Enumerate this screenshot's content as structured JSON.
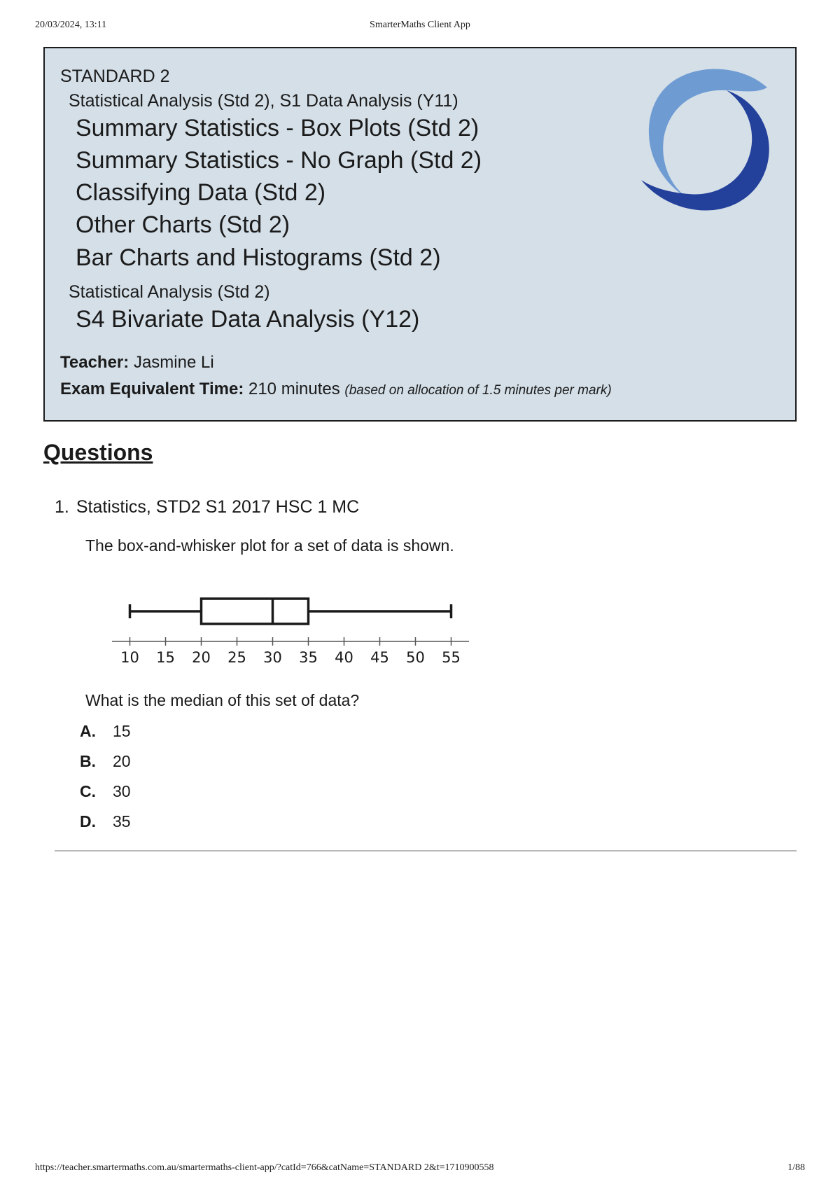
{
  "print_header": {
    "datetime": "20/03/2024, 13:11",
    "title": "SmarterMaths Client App"
  },
  "banner": {
    "course": "STANDARD 2",
    "categories": [
      "Statistical Analysis (Std 2), S1 Data Analysis (Y11)",
      "Statistical Analysis (Std 2)"
    ],
    "topics": [
      "Summary Statistics - Box Plots (Std 2)",
      "Summary Statistics - No Graph (Std 2)",
      "Classifying Data (Std 2)",
      "Other Charts (Std 2)",
      "Bar Charts and Histograms (Std 2)",
      "S4 Bivariate Data Analysis (Y12)"
    ],
    "teacher_label": "Teacher:",
    "teacher_name": "Jasmine Li",
    "exam_time_label": "Exam Equivalent Time:",
    "exam_time_value": "210 minutes",
    "exam_time_note": "(based on allocation of 1.5 minutes per mark)",
    "logo_colors": {
      "light": "#6f9bd3",
      "dark": "#23409a"
    }
  },
  "questions_heading": "Questions",
  "question": {
    "number": "1.",
    "title": "Statistics, STD2 S1 2017 HSC 1 MC",
    "text1": "The box-and-whisker plot for a set of data is shown.",
    "text2": "What is the median of this set of data?",
    "options": [
      {
        "letter": "A.",
        "value": "15"
      },
      {
        "letter": "B.",
        "value": "20"
      },
      {
        "letter": "C.",
        "value": "30"
      },
      {
        "letter": "D.",
        "value": "35"
      }
    ]
  },
  "chart_data": {
    "type": "boxplot",
    "min": 10,
    "q1": 20,
    "median": 30,
    "q3": 35,
    "max": 55,
    "axis_ticks": [
      10,
      15,
      20,
      25,
      30,
      35,
      40,
      45,
      50,
      55
    ],
    "xlim": [
      7.5,
      57.5
    ]
  },
  "print_footer": {
    "url": "https://teacher.smartermaths.com.au/smartermaths-client-app/?catId=766&catName=STANDARD 2&t=1710900558",
    "page": "1/88"
  }
}
